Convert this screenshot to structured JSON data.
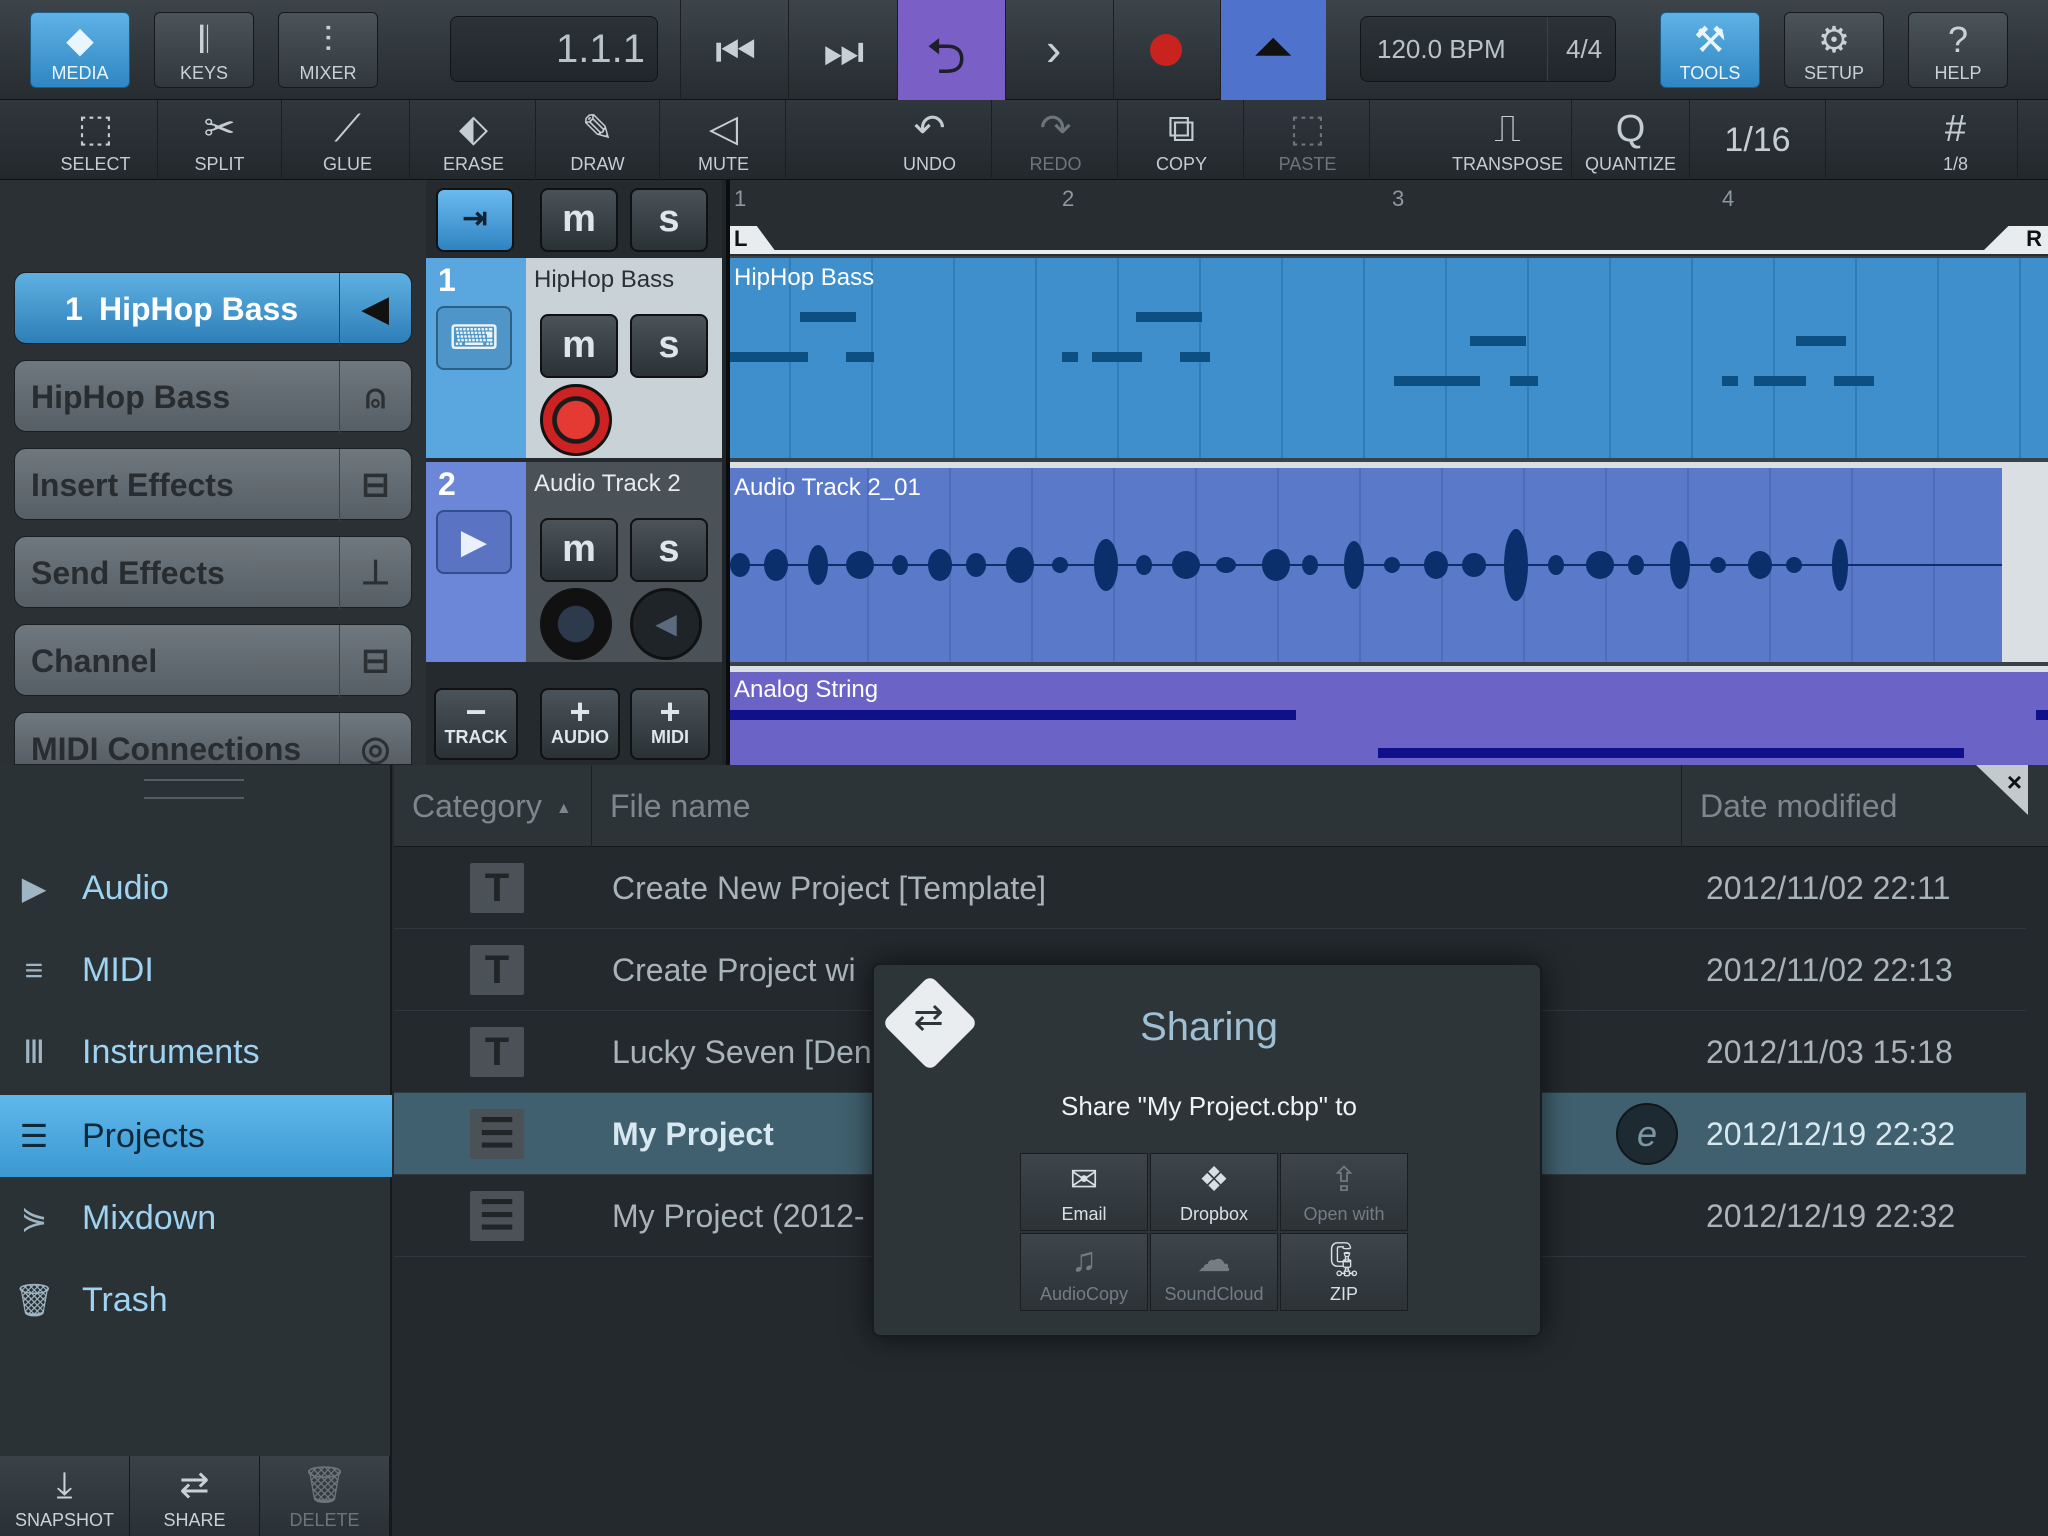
{
  "topbar": {
    "media": "MEDIA",
    "keys": "KEYS",
    "mixer": "MIXER",
    "position": "1.1.1",
    "tempo": "120.0 BPM",
    "signature": "4/4",
    "tools": "TOOLS",
    "setup": "SETUP",
    "help": "HELP"
  },
  "toolbar2": {
    "select": "SELECT",
    "split": "SPLIT",
    "glue": "GLUE",
    "erase": "ERASE",
    "draw": "DRAW",
    "mute": "MUTE",
    "undo": "UNDO",
    "redo": "REDO",
    "copy": "COPY",
    "paste": "PASTE",
    "transpose": "TRANSPOSE",
    "quantize": "QUANTIZE",
    "quantize_value": "1/16",
    "grid_value": "1/8"
  },
  "inspector": {
    "track_number": "1",
    "track_name": "HipHop Bass",
    "instrument": "HipHop Bass",
    "insert_effects": "Insert Effects",
    "send_effects": "Send Effects",
    "channel": "Channel",
    "midi_connections": "MIDI Connections"
  },
  "tracks": [
    {
      "number": "1",
      "name": "HipHop Bass",
      "part": "HipHop Bass",
      "color": "#3f8fcd"
    },
    {
      "number": "2",
      "name": "Audio Track 2",
      "part": "Audio Track 2_01",
      "color": "#5b79c9"
    },
    {
      "part": "Analog String",
      "color": "#6b63c6"
    }
  ],
  "track_buttons": {
    "m": "m",
    "s": "s",
    "track": "TRACK",
    "audio": "AUDIO",
    "midi": "MIDI"
  },
  "ruler": {
    "marks": [
      "1",
      "2",
      "3",
      "4"
    ],
    "left_locator": "L",
    "right_locator": "R"
  },
  "browser": {
    "columns": {
      "category": "Category",
      "file_name": "File name",
      "date_modified": "Date modified"
    },
    "categories": [
      "Audio",
      "MIDI",
      "Instruments",
      "Projects",
      "Mixdown",
      "Trash"
    ],
    "selected_category": "Projects",
    "files": [
      {
        "icon": "T",
        "name": "Create New Project [Template]",
        "date": "2012/11/02 22:11"
      },
      {
        "icon": "T",
        "name": "Create Project wi",
        "date": "2012/11/02 22:13"
      },
      {
        "icon": "T",
        "name": "Lucky Seven [Den",
        "date": "2012/11/03 15:18"
      },
      {
        "icon": "list",
        "name": "My Project",
        "date": "2012/12/19 22:32"
      },
      {
        "icon": "list",
        "name": "My Project (2012-",
        "date": "2012/12/19 22:32"
      }
    ],
    "bottom_buttons": {
      "snapshot": "SNAPSHOT",
      "share": "SHARE",
      "delete": "DELETE"
    },
    "edit_badge": "e"
  },
  "dialog": {
    "title": "Sharing",
    "message": "Share \"My Project.cbp\" to",
    "options": [
      "Email",
      "Dropbox",
      "Open with",
      "AudioCopy",
      "SoundCloud",
      "ZIP"
    ]
  }
}
